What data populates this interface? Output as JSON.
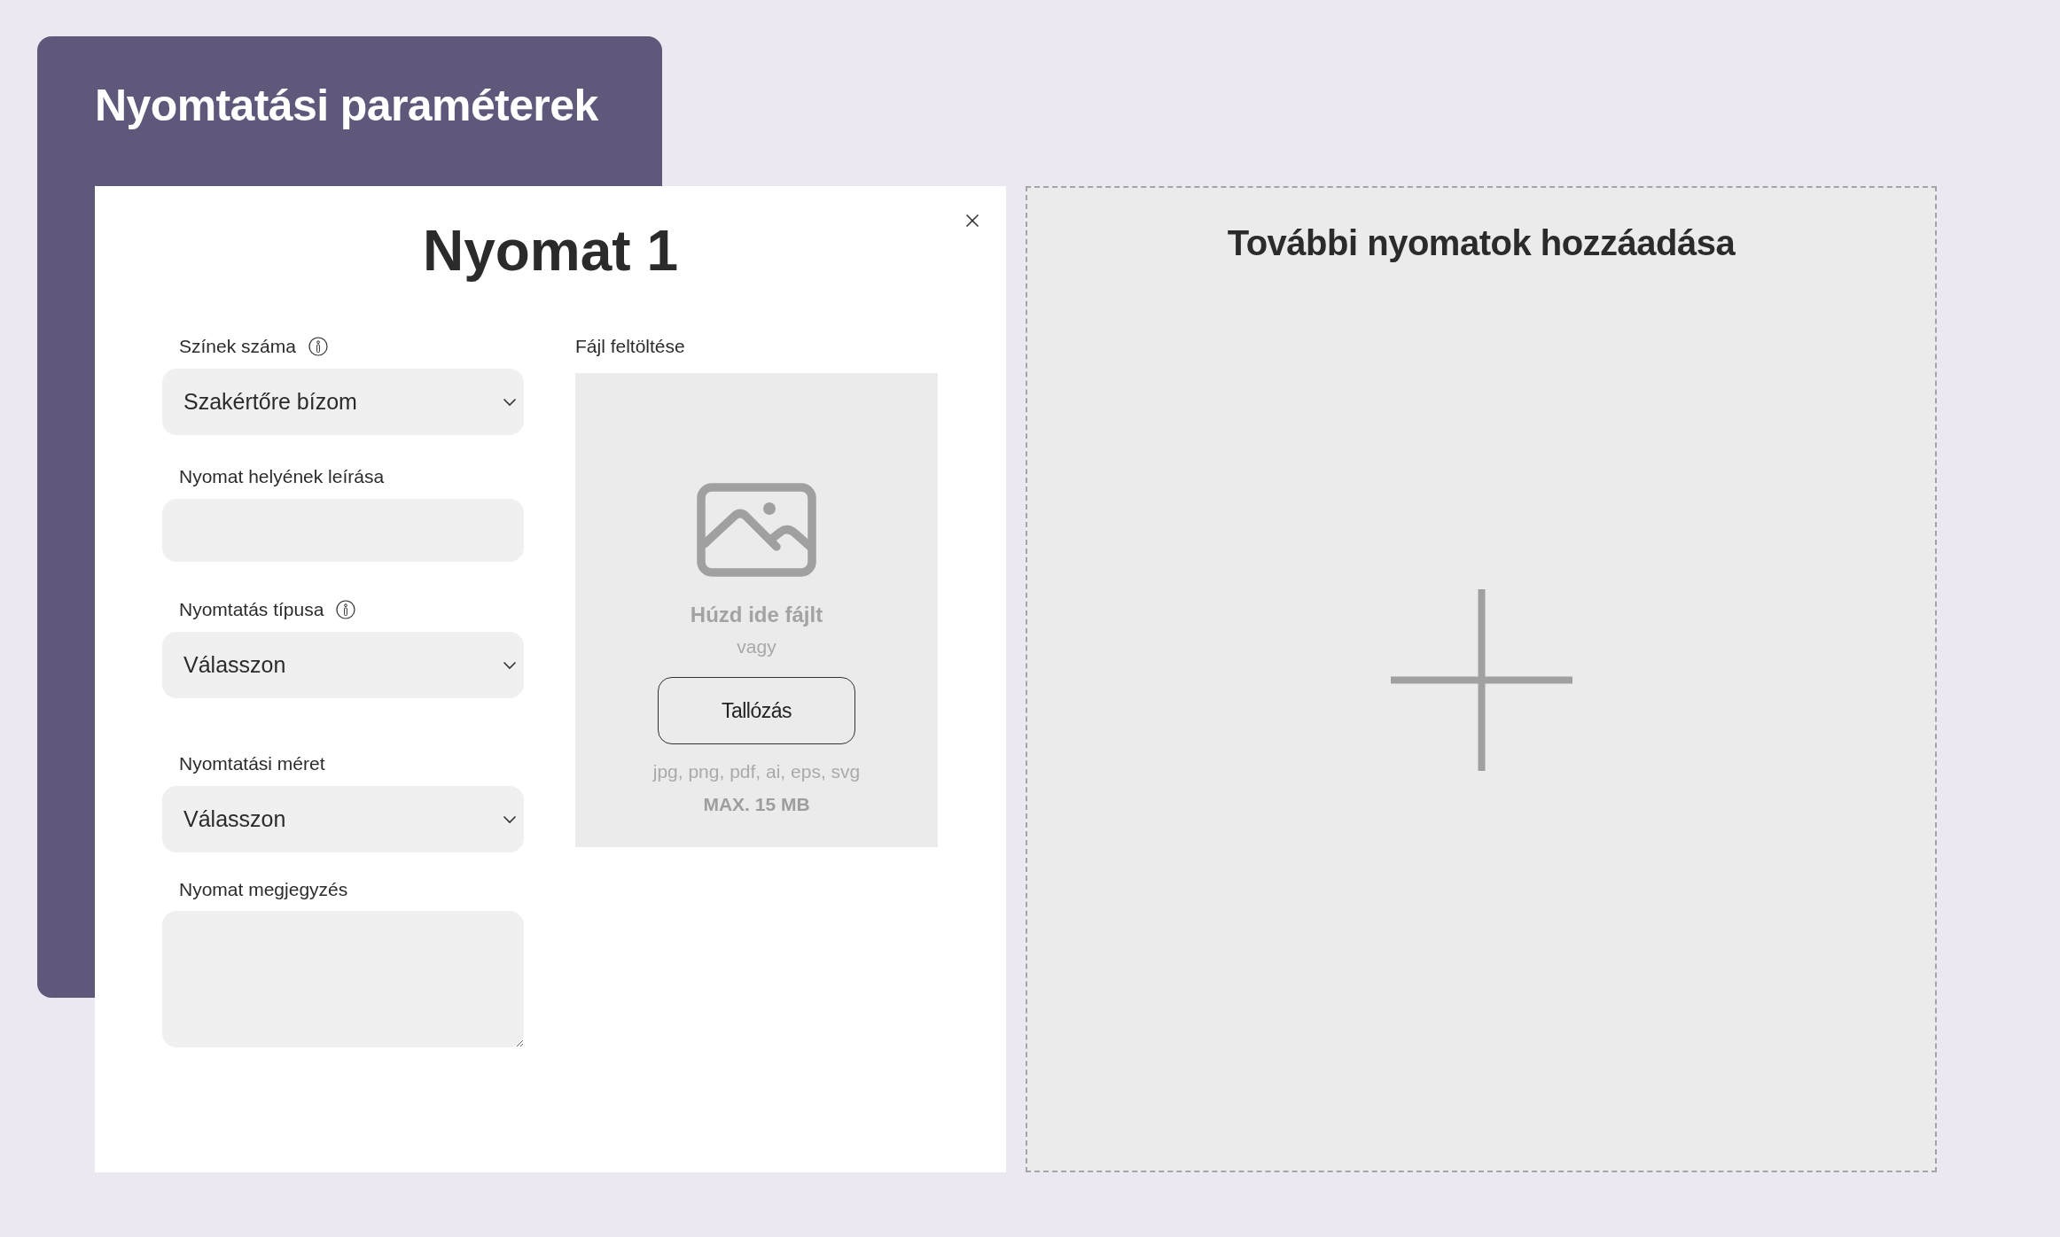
{
  "page_title": "Nyomtatási paraméterek",
  "print_card": {
    "title": "Nyomat 1",
    "fields": [
      {
        "kind": "select",
        "label": "Színek száma",
        "info": true,
        "value": "Szakértőre bízom"
      },
      {
        "kind": "text",
        "label": "Nyomat helyének leírása",
        "info": false
      },
      {
        "kind": "select",
        "label": "Nyomtatás típusa",
        "info": true,
        "value": "Válasszon"
      },
      {
        "kind": "select",
        "label": "Nyomtatási méret",
        "info": false,
        "value": "Válasszon"
      },
      {
        "kind": "textarea",
        "label": "Nyomat megjegyzés",
        "info": false
      }
    ],
    "upload": {
      "label": "Fájl feltöltése",
      "drop_text": "Húzd ide fájlt",
      "or_text": "vagy",
      "browse_button": "Tallózás",
      "formats": "jpg, png, pdf, ai, eps, svg",
      "max_size": "MAX. 15 MB"
    }
  },
  "add_panel": {
    "title": "További nyomatok hozzáadása"
  }
}
